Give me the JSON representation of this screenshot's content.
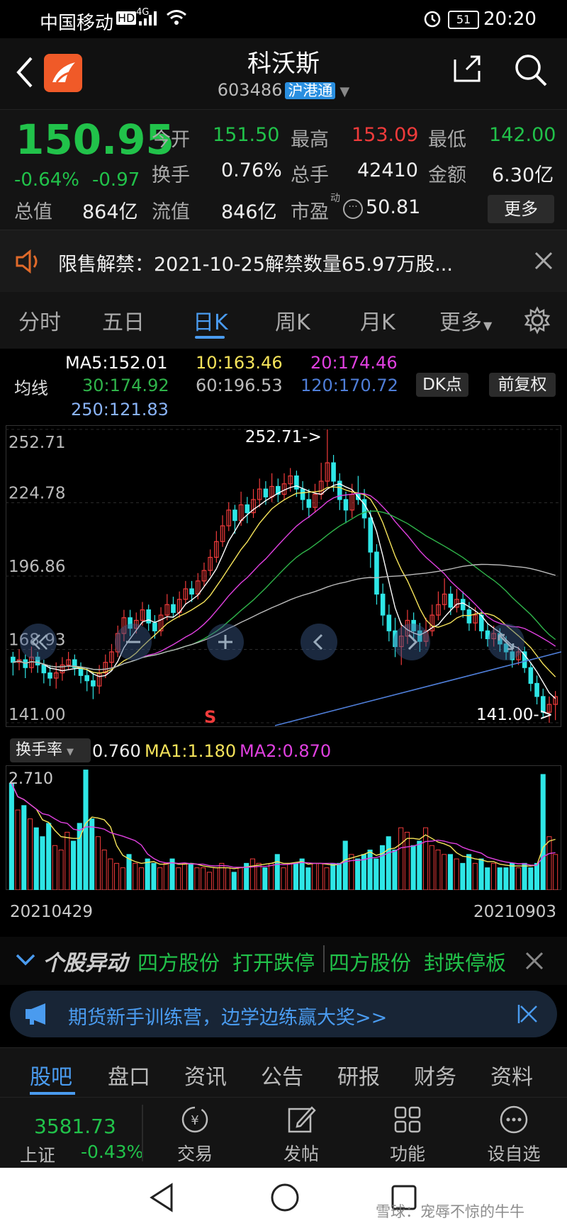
{
  "status_bar": {
    "carrier": "中国移动",
    "hd": "HD",
    "net": "4G",
    "battery": "51",
    "time": "20:20"
  },
  "header": {
    "title": "科沃斯",
    "code": "603486",
    "tag": "沪港通"
  },
  "quote": {
    "price": "150.95",
    "change_pct": "-0.64%",
    "change": "-0.97",
    "open_label": "今开",
    "open": "151.50",
    "high_label": "最高",
    "high": "153.09",
    "low_label": "最低",
    "low": "142.00",
    "turnover_label": "换手",
    "turnover": "0.76%",
    "volume_label": "总手",
    "volume": "42410",
    "amount_label": "金额",
    "amount": "6.30亿",
    "mcap_label": "总值",
    "mcap": "864亿",
    "float_label": "流值",
    "float_cap": "846亿",
    "pe_label": "市盈",
    "pe_sup": "动",
    "pe": "50.81",
    "more_label": "更多"
  },
  "notice": {
    "text": "限售解禁：2021-10-25解禁数量65.97万股..."
  },
  "ktabs": {
    "items": [
      "分时",
      "五日",
      "日K",
      "周K",
      "月K",
      "更多"
    ],
    "active": "日K"
  },
  "ma": {
    "label": "均线",
    "ma5": "MA5:152.01",
    "ma10": "10:163.46",
    "ma20": "20:174.46",
    "ma30": "30:174.92",
    "ma60": "60:196.53",
    "ma120": "120:170.72",
    "ma250": "250:121.83",
    "dk_label": "DK点",
    "adj_label": "前复权",
    "colors": {
      "ma5": "#ffffff",
      "ma10": "#f5e35a",
      "ma20": "#e040e0",
      "ma30": "#2fb44a",
      "ma60": "#bbbbbb",
      "ma120": "#4f7ed8",
      "ma250": "#8ab4f8"
    }
  },
  "chart_data": [
    {
      "type": "candlestick",
      "title": "",
      "y_ticks": [
        "252.71",
        "224.78",
        "196.86",
        "168.93",
        "141.00"
      ],
      "ylim": [
        141.0,
        252.71
      ],
      "max_marker": "252.71->",
      "min_marker": "141.00->",
      "signal": "S",
      "colors": {
        "up": "#f03b3b",
        "down": "#2ee6e6"
      },
      "candles": [
        [
          166,
          164,
          168,
          159
        ],
        [
          164,
          165,
          169,
          161
        ],
        [
          165,
          162,
          167,
          158
        ],
        [
          162,
          166,
          170,
          160
        ],
        [
          166,
          163,
          168,
          160
        ],
        [
          163,
          160,
          165,
          156
        ],
        [
          160,
          158,
          163,
          155
        ],
        [
          158,
          160,
          164,
          154
        ],
        [
          160,
          163,
          166,
          157
        ],
        [
          163,
          165,
          168,
          161
        ],
        [
          165,
          162,
          167,
          159
        ],
        [
          162,
          159,
          164,
          156
        ],
        [
          159,
          157,
          162,
          153
        ],
        [
          157,
          155,
          160,
          150
        ],
        [
          155,
          160,
          163,
          152
        ],
        [
          160,
          164,
          167,
          158
        ],
        [
          164,
          168,
          171,
          162
        ],
        [
          168,
          175,
          178,
          166
        ],
        [
          175,
          181,
          184,
          172
        ],
        [
          181,
          177,
          184,
          174
        ],
        [
          177,
          180,
          183,
          175
        ],
        [
          180,
          184,
          187,
          178
        ],
        [
          184,
          179,
          186,
          176
        ],
        [
          179,
          176,
          182,
          173
        ],
        [
          176,
          182,
          185,
          174
        ],
        [
          182,
          186,
          190,
          180
        ],
        [
          186,
          183,
          189,
          181
        ],
        [
          183,
          188,
          191,
          181
        ],
        [
          188,
          192,
          195,
          186
        ],
        [
          192,
          190,
          195,
          187
        ],
        [
          190,
          195,
          198,
          188
        ],
        [
          195,
          199,
          202,
          193
        ],
        [
          199,
          204,
          207,
          197
        ],
        [
          204,
          210,
          214,
          202
        ],
        [
          210,
          216,
          220,
          208
        ],
        [
          216,
          222,
          225,
          214
        ],
        [
          222,
          218,
          224,
          213
        ],
        [
          218,
          224,
          229,
          216
        ],
        [
          224,
          221,
          227,
          217
        ],
        [
          221,
          226,
          230,
          219
        ],
        [
          226,
          230,
          234,
          223
        ],
        [
          230,
          227,
          233,
          224
        ],
        [
          227,
          231,
          236,
          225
        ],
        [
          231,
          228,
          234,
          225
        ],
        [
          228,
          232,
          236,
          226
        ],
        [
          232,
          235,
          238,
          229
        ],
        [
          235,
          230,
          237,
          227
        ],
        [
          230,
          226,
          233,
          222
        ],
        [
          226,
          223,
          230,
          219
        ],
        [
          223,
          228,
          232,
          221
        ],
        [
          228,
          233,
          240,
          226
        ],
        [
          233,
          240,
          252.71,
          231
        ],
        [
          240,
          233,
          243,
          229
        ],
        [
          233,
          226,
          236,
          222
        ],
        [
          226,
          222,
          229,
          217
        ],
        [
          222,
          228,
          232,
          219
        ],
        [
          228,
          226,
          235,
          224
        ],
        [
          226,
          219,
          230,
          215
        ],
        [
          219,
          206,
          222,
          200
        ],
        [
          206,
          190,
          209,
          186
        ],
        [
          190,
          182,
          194,
          178
        ],
        [
          182,
          176,
          186,
          172
        ],
        [
          176,
          170,
          181,
          166
        ],
        [
          170,
          174,
          179,
          163
        ],
        [
          174,
          180,
          184,
          171
        ],
        [
          180,
          176,
          183,
          172
        ],
        [
          176,
          172,
          179,
          168
        ],
        [
          172,
          176,
          181,
          170
        ],
        [
          176,
          182,
          186,
          174
        ],
        [
          182,
          186,
          191,
          180
        ],
        [
          186,
          190,
          196,
          184
        ],
        [
          190,
          185,
          193,
          182
        ],
        [
          185,
          188,
          192,
          183
        ],
        [
          188,
          184,
          191,
          181
        ],
        [
          184,
          179,
          187,
          176
        ],
        [
          179,
          182,
          185,
          176
        ],
        [
          182,
          176,
          184,
          173
        ],
        [
          176,
          173,
          179,
          170
        ],
        [
          173,
          175,
          178,
          170
        ],
        [
          175,
          171,
          177,
          168
        ],
        [
          171,
          168,
          174,
          165
        ],
        [
          168,
          165,
          171,
          162
        ],
        [
          165,
          168,
          170,
          163
        ],
        [
          168,
          162,
          170,
          160
        ],
        [
          162,
          156,
          164,
          153
        ],
        [
          156,
          151,
          159,
          148
        ],
        [
          151,
          145,
          154,
          143
        ],
        [
          145,
          148,
          151,
          141
        ],
        [
          148,
          150.95,
          153.09,
          142
        ]
      ]
    },
    {
      "type": "bar",
      "title": "",
      "indicator_label": "换手率",
      "value": "0.760",
      "ma1": "MA1:1.180",
      "ma2": "MA2:0.870",
      "y_max_label": "2.710",
      "x_start": "20210429",
      "x_end": "20210903",
      "ylim": [
        0,
        2.71
      ],
      "values": [
        2.4,
        1.8,
        1.9,
        1.6,
        1.4,
        1.2,
        1.5,
        1.0,
        0.9,
        1.3,
        1.1,
        1.5,
        2.7,
        1.6,
        1.2,
        0.9,
        0.7,
        0.6,
        0.5,
        0.8,
        0.6,
        0.5,
        0.7,
        0.6,
        0.5,
        0.6,
        0.7,
        0.5,
        0.6,
        0.6,
        0.5,
        0.5,
        0.4,
        0.5,
        0.6,
        0.5,
        0.4,
        0.5,
        0.6,
        0.7,
        0.6,
        0.5,
        0.6,
        0.8,
        0.5,
        0.6,
        0.6,
        0.7,
        0.5,
        0.6,
        0.6,
        0.5,
        0.6,
        0.6,
        1.1,
        0.8,
        0.7,
        0.8,
        0.9,
        0.7,
        1.0,
        1.2,
        0.9,
        1.4,
        1.3,
        1.0,
        1.1,
        1.4,
        1.0,
        0.9,
        0.8,
        0.8,
        0.7,
        0.6,
        0.8,
        0.6,
        0.7,
        0.5,
        0.6,
        0.5,
        0.5,
        0.6,
        0.5,
        0.6,
        0.5,
        0.6,
        2.6,
        1.2,
        0.8
      ]
    }
  ],
  "movement": {
    "title": "个股异动",
    "item1_name": "四方股份",
    "item1_action": "打开跌停",
    "item2_name": "四方股份",
    "item2_action": "封跌停板"
  },
  "ad": {
    "text": "期货新手训练营，边学边练赢大奖>>"
  },
  "bottom_tabs": {
    "items": [
      "股吧",
      "盘口",
      "资讯",
      "公告",
      "研报",
      "财务",
      "资料"
    ],
    "active": "股吧"
  },
  "tools": {
    "index_value": "3581.73",
    "index_name": "上证",
    "index_change": "-0.43%",
    "trade": "交易",
    "post": "发帖",
    "function": "功能",
    "watchlist": "设自选"
  },
  "watermark": "雪球：宠辱不惊的牛牛"
}
